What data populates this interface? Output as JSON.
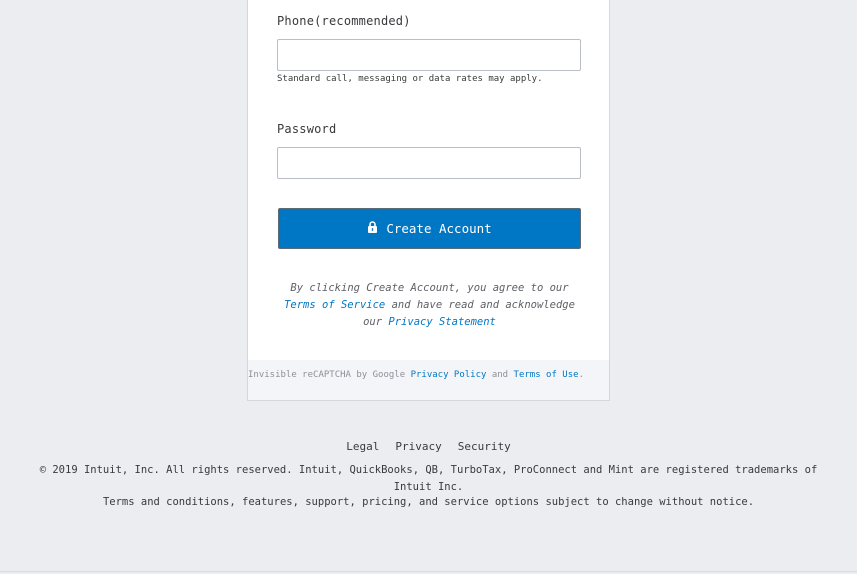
{
  "form": {
    "phone_label": "Phone(recommended)",
    "phone_value": "",
    "phone_hint": "Standard call, messaging or data rates may apply.",
    "password_label": "Password",
    "password_value": "",
    "submit_label": "Create Account",
    "submit_icon": "lock-icon",
    "button_color": "#0077c5"
  },
  "agreement": {
    "line1": "By clicking Create Account, you agree to our",
    "terms_link": "Terms of Service",
    "middle": "and have read and acknowledge",
    "our": "our",
    "privacy_link": "Privacy Statement"
  },
  "recaptcha": {
    "prefix": "Invisible reCAPTCHA by Google",
    "privacy_link": "Privacy Policy",
    "and": "and",
    "terms_link": "Terms of Use",
    "suffix": "."
  },
  "footer": {
    "links": [
      "Legal",
      "Privacy",
      "Security"
    ],
    "copyright": "© 2019 Intuit, Inc. All rights reserved. Intuit, QuickBooks, QB, TurboTax, ProConnect and Mint are registered trademarks of Intuit Inc.",
    "terms": "Terms and conditions, features, support, pricing, and service options subject to change without notice."
  }
}
